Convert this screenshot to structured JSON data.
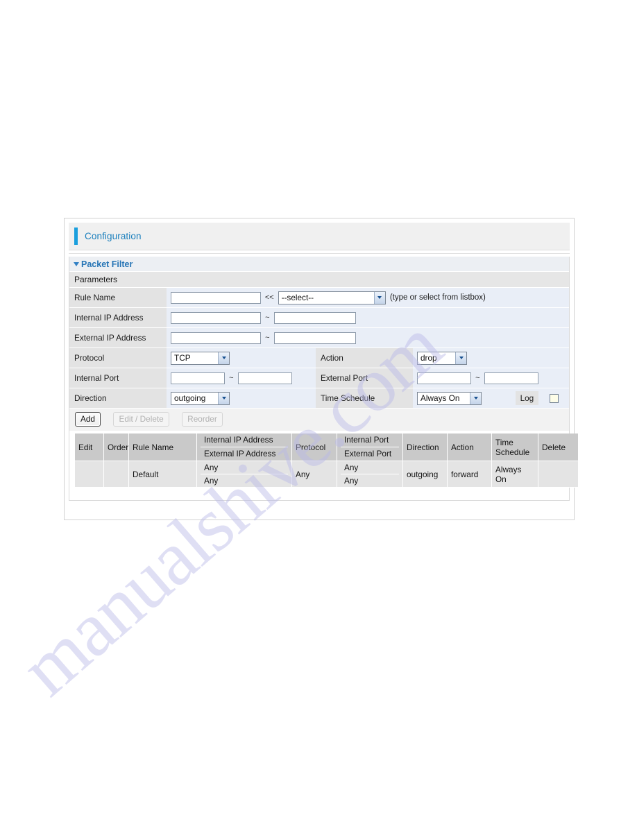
{
  "watermark": {
    "text": "manualshive.com"
  },
  "page": {
    "header": {
      "title": "Configuration",
      "accent_color": "#1a9fdd"
    },
    "section": {
      "title": "Packet Filter",
      "title_color": "#2574b5",
      "toggle_icon": "triangle-down-icon"
    },
    "params_bar": {
      "label": "Parameters"
    }
  },
  "form": {
    "rule_name": {
      "label": "Rule Name",
      "input_value": "",
      "arrow_marker": "<<",
      "select_value": "--select--",
      "hint": "(type or select from listbox)"
    },
    "internal_ip": {
      "label": "Internal IP Address",
      "from_value": "",
      "separator": "~",
      "to_value": ""
    },
    "external_ip": {
      "label": "External IP Address",
      "from_value": "",
      "separator": "~",
      "to_value": ""
    },
    "protocol": {
      "label": "Protocol",
      "value": "TCP"
    },
    "action": {
      "label": "Action",
      "value": "drop"
    },
    "internal_port": {
      "label": "Internal Port",
      "from_value": "",
      "separator": "~",
      "to_value": ""
    },
    "external_port": {
      "label": "External Port",
      "from_value": "",
      "separator": "~",
      "to_value": ""
    },
    "direction": {
      "label": "Direction",
      "value": "outgoing"
    },
    "time_schedule": {
      "label": "Time Schedule",
      "value": "Always On"
    },
    "log": {
      "label": "Log",
      "checked": false
    }
  },
  "buttons": {
    "add": {
      "label": "Add",
      "state": "enabled"
    },
    "edit_delete": {
      "label": "Edit / Delete",
      "state": "disabled"
    },
    "reorder": {
      "label": "Reorder",
      "state": "disabled"
    }
  },
  "rules_table": {
    "headers": {
      "edit": "Edit",
      "order": "Order",
      "rule_name": "Rule Name",
      "internal_ip": "Internal IP Address",
      "external_ip": "External IP Address",
      "protocol": "Protocol",
      "internal_port": "Internal Port",
      "external_port": "External Port",
      "direction": "Direction",
      "action": "Action",
      "time_schedule": "Time Schedule",
      "delete": "Delete"
    },
    "rows": [
      {
        "edit": "",
        "order": "",
        "rule_name": "Default",
        "internal_ip": "Any",
        "external_ip": "Any",
        "protocol": "Any",
        "internal_port": "Any",
        "external_port": "Any",
        "direction": "outgoing",
        "action": "forward",
        "time_schedule": "Always On",
        "delete": ""
      }
    ]
  }
}
